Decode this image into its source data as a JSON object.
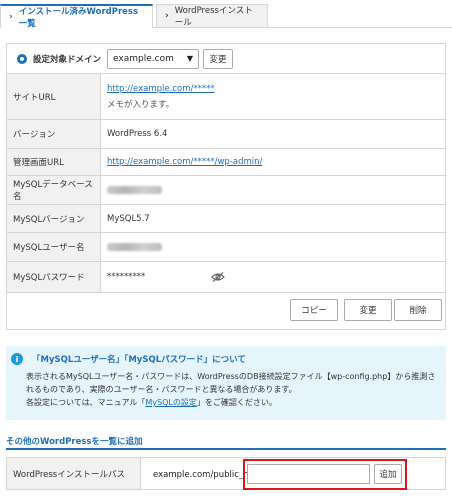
{
  "tabs": [
    {
      "label": "インストール済みWordPress一覧",
      "active": true
    },
    {
      "label": "WordPressインストール",
      "active": false
    }
  ],
  "domain": {
    "label": "設定対象ドメイン",
    "selected": "example.com",
    "change_label": "変更"
  },
  "info": {
    "site_url": {
      "label": "サイトURL",
      "value": "http://example.com/*****",
      "memo": "メモが入ります。"
    },
    "version": {
      "label": "バージョン",
      "value": "WordPress 6.4"
    },
    "admin_url": {
      "label": "管理画面URL",
      "value": "http://example.com/*****/wp-admin/"
    },
    "db_name": {
      "label": "MySQLデータベース名"
    },
    "mysql_version": {
      "label": "MySQLバージョン",
      "value": "MySQL5.7"
    },
    "db_user": {
      "label": "MySQLユーザー名"
    },
    "db_password": {
      "label": "MySQLパスワード",
      "value": "*********"
    }
  },
  "actions": {
    "copy": "コピー",
    "change": "変更",
    "delete": "削除"
  },
  "notice": {
    "title": "「MySQLユーザー名」「MySQLパスワード」について",
    "line1": "表示されるMySQLユーザー名・パスワードは、WordPressのDB接続設定ファイル【wp-config.php】から推測さ",
    "line2": "れるものであり、実際のユーザー名・パスワードと異なる場合があります。",
    "line3_pre": "各設定については、マニュアル「",
    "line3_link": "MySQLの設定",
    "line3_post": "」をご確認ください。"
  },
  "add_section": {
    "title": "その他のWordPressを一覧に追加",
    "path_label": "WordPressインストールパス",
    "path_prefix": "example.com/public_html/",
    "input_value": "",
    "add_label": "追加"
  },
  "colors": {
    "accent": "#1e6fb8",
    "notice_bg": "#e6f4fb",
    "highlight": "#d61a1a"
  }
}
